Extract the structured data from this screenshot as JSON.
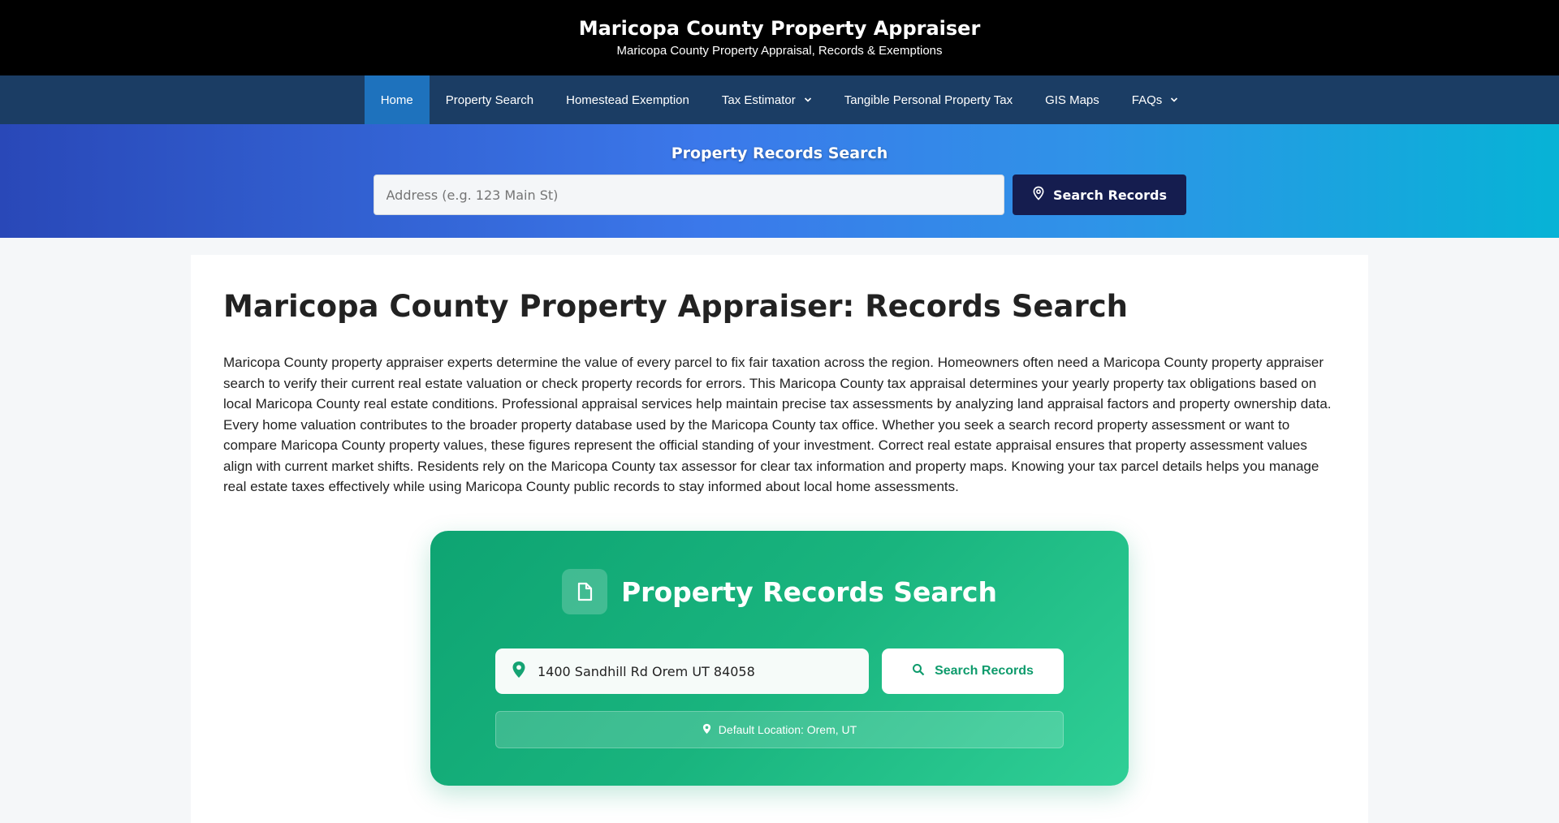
{
  "header": {
    "title": "Maricopa County Property Appraiser",
    "tagline": "Maricopa County Property Appraisal, Records & Exemptions"
  },
  "nav": {
    "items": [
      {
        "label": "Home",
        "active": true
      },
      {
        "label": "Property Search"
      },
      {
        "label": "Homestead Exemption"
      },
      {
        "label": "Tax Estimator",
        "dropdown": true
      },
      {
        "label": "Tangible Personal Property Tax"
      },
      {
        "label": "GIS Maps"
      },
      {
        "label": "FAQs",
        "dropdown": true
      }
    ]
  },
  "hero": {
    "title": "Property Records Search",
    "placeholder": "Address (e.g. 123 Main St)",
    "button_label": "Search Records"
  },
  "main": {
    "title": "Maricopa County Property Appraiser: Records Search",
    "intro": "Maricopa County property appraiser experts determine the value of every parcel to fix fair taxation across the region. Homeowners often need a Maricopa County property appraiser search to verify their current real estate valuation or check property records for errors. This Maricopa County tax appraisal determines your yearly property tax obligations based on local Maricopa County real estate conditions. Professional appraisal services help maintain precise tax assessments by analyzing land appraisal factors and property ownership data. Every home valuation contributes to the broader property database used by the Maricopa County tax office. Whether you seek a search record property assessment or want to compare Maricopa County property values, these figures represent the official standing of your investment. Correct real estate appraisal ensures that property assessment values align with current market shifts. Residents rely on the Maricopa County tax assessor for clear tax information and property maps. Knowing your tax parcel details helps you manage real estate taxes effectively while using Maricopa County public records to stay informed about local home assessments."
  },
  "card": {
    "title": "Property Records Search",
    "address_value": "1400 Sandhill Rd Orem UT 84058",
    "button_label": "Search Records",
    "default_location": "Default Location: Orem, UT"
  },
  "icons": {
    "hero_button": "map-pin-icon",
    "card_header": "document-icon",
    "card_input": "location-pin-icon",
    "card_button": "search-icon",
    "default_location": "location-pin-icon"
  },
  "colors": {
    "header_bg": "#000000",
    "nav_bg": "#1b3d64",
    "nav_active": "#1e72bd",
    "hero_button": "#151d4f",
    "card_green": "#19b47e"
  }
}
